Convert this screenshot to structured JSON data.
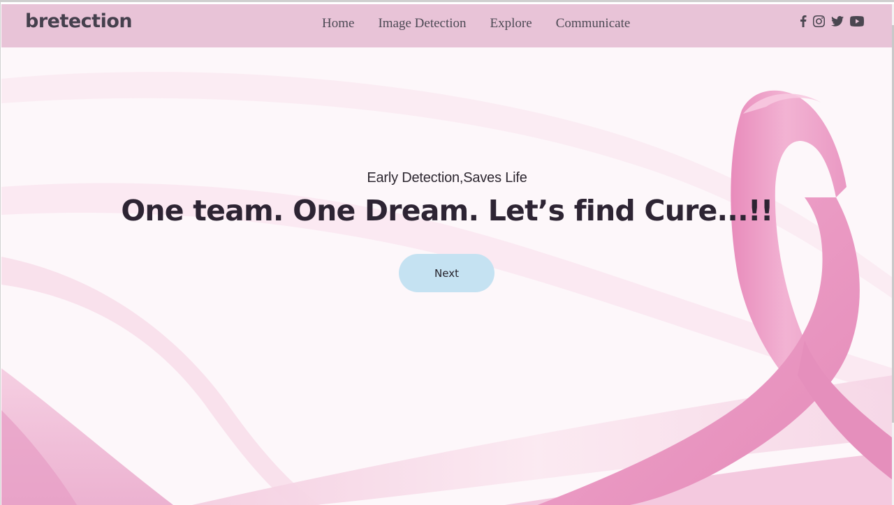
{
  "brand": {
    "name": "bretection"
  },
  "nav": {
    "items": [
      {
        "label": "Home"
      },
      {
        "label": "Image Detection"
      },
      {
        "label": "Explore"
      },
      {
        "label": "Communicate"
      }
    ]
  },
  "socials": [
    "facebook-icon",
    "instagram-icon",
    "twitter-icon",
    "youtube-icon"
  ],
  "hero": {
    "subtitle": "Early Detection,Saves Life",
    "headline": "One team. One Dream. Let’s find Cure...!!",
    "button_label": "Next"
  },
  "colors": {
    "navbar": "#e8c3d7",
    "hero_bg": "#fdf7fa",
    "ribbon": "#ea9dc4",
    "button": "#c5e2f2",
    "text_dark": "#2d2433"
  }
}
